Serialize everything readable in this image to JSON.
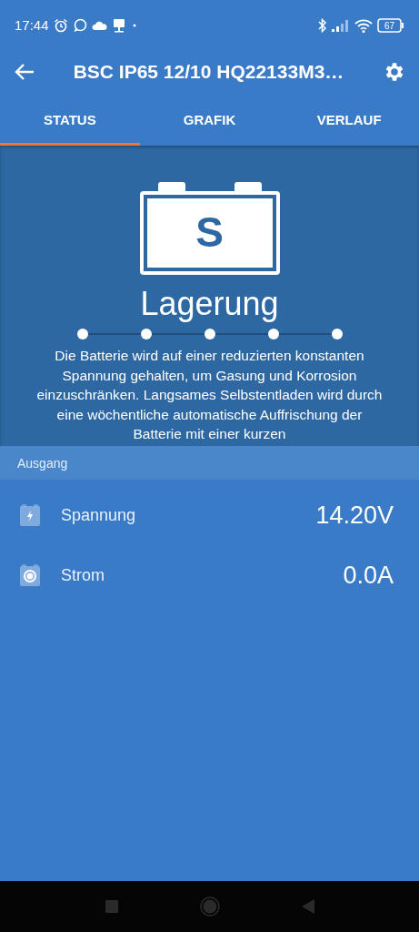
{
  "status_bar": {
    "time": "17:44",
    "battery": "67"
  },
  "app_bar": {
    "title": "BSC IP65 12/10 HQ22133M3…"
  },
  "tabs": [
    {
      "label": "STATUS",
      "selected": true
    },
    {
      "label": "GRAFIK",
      "selected": false
    },
    {
      "label": "VERLAUF",
      "selected": false
    }
  ],
  "state": {
    "letter": "S",
    "name": "Lagerung",
    "description": "Die Batterie wird auf einer reduzierten konstanten Spannung gehalten, um Gasung und Korrosion einzuschränken. Langsames Selbstentladen wird durch eine wöchentliche automatische Auffrischung der Batterie mit einer kurzen"
  },
  "section": {
    "title": "Ausgang"
  },
  "rows": [
    {
      "kind": "voltage",
      "label": "Spannung",
      "value": "14.20V"
    },
    {
      "kind": "current",
      "label": "Strom",
      "value": "0.0A"
    }
  ]
}
